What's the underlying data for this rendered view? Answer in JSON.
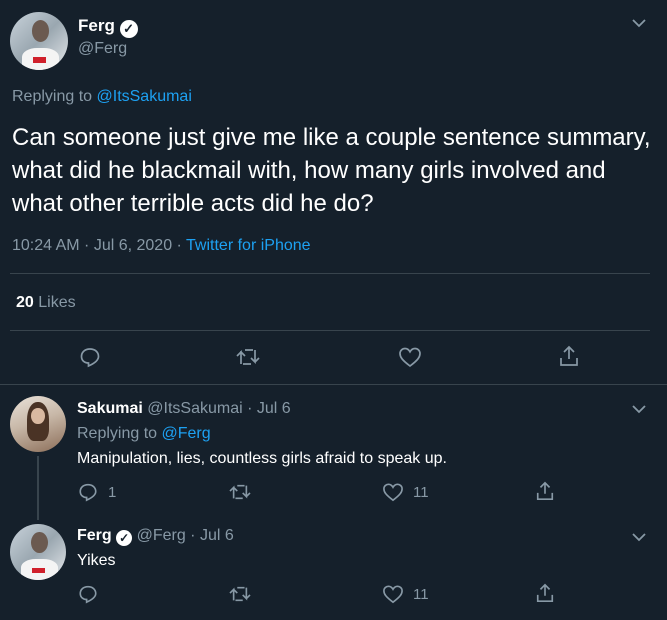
{
  "main": {
    "name": "Ferg",
    "handle": "@Ferg",
    "replying_prefix": "Replying to",
    "replying_to": "@ItsSakumai",
    "text": "Can someone just give me like a couple sentence summary, what did he blackmail with, how many girls involved and what other terrible acts did he do?",
    "time_date": "10:24 AM · Jul 6, 2020 ·",
    "source": "Twitter for iPhone",
    "likes_count": "20",
    "likes_label": "Likes"
  },
  "replies": [
    {
      "name": "Sakumai",
      "handle_date": "@ItsSakumai · Jul 6",
      "replying_prefix": "Replying to",
      "replying_to": "@Ferg",
      "text": "Manipulation, lies, countless girls afraid to speak up.",
      "reply_count": "1",
      "like_count": "11"
    },
    {
      "name": "Ferg",
      "handle_date": "@Ferg · Jul 6",
      "text": "Yikes",
      "like_count": "11"
    }
  ],
  "icons": {
    "verified": "verified-badge-icon",
    "chevron": "chevron-down-icon",
    "reply": "reply-icon",
    "retweet": "retweet-icon",
    "like": "heart-icon",
    "share": "share-icon"
  },
  "colors": {
    "background": "#15202b",
    "text": "#ffffff",
    "muted": "#8899a6",
    "link": "#1da1f2",
    "divider": "#38444d"
  }
}
